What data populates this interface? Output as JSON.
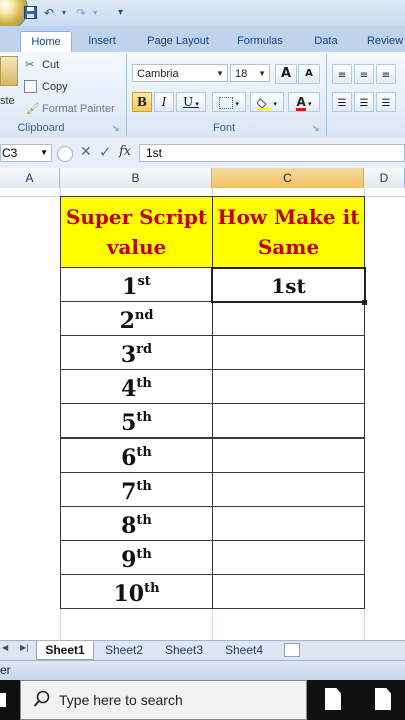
{
  "qat": {
    "icons": [
      "save-icon",
      "undo-icon",
      "redo-icon",
      "customize-icon"
    ]
  },
  "tabs": [
    {
      "label": "Home",
      "active": true
    },
    {
      "label": "Insert"
    },
    {
      "label": "Page Layout"
    },
    {
      "label": "Formulas"
    },
    {
      "label": "Data"
    },
    {
      "label": "Review"
    }
  ],
  "clipboard": {
    "paste_label": "ste",
    "cut_label": "Cut",
    "copy_label": "Copy",
    "format_painter_label": "Format Painter",
    "group_label": "Clipboard"
  },
  "font": {
    "name": "Cambria",
    "size": "18",
    "grow": "A",
    "shrink": "A",
    "bold": "B",
    "italic": "I",
    "underline": "U",
    "color_letter": "A",
    "group_label": "Font",
    "fill_color": "#ffff00",
    "font_color": "#ff0000"
  },
  "formula_bar": {
    "name_box": "C3",
    "fx": "fx",
    "value": "1st"
  },
  "columns": [
    {
      "label": "A"
    },
    {
      "label": "B"
    },
    {
      "label": "C",
      "selected": true
    },
    {
      "label": "D"
    }
  ],
  "table": {
    "header_b_line1": "Super Script",
    "header_b_line2": "value",
    "header_c_line1": "How Make it",
    "header_c_line2": "Same",
    "header_fill": "#ffff00",
    "header_text_color": "#c00000",
    "rows": [
      {
        "num": "1",
        "sup": "st",
        "c": "1st"
      },
      {
        "num": "2",
        "sup": "nd",
        "c": ""
      },
      {
        "num": "3",
        "sup": "rd",
        "c": ""
      },
      {
        "num": "4",
        "sup": "th",
        "c": ""
      },
      {
        "num": "5",
        "sup": "th",
        "c": ""
      },
      {
        "num": "6",
        "sup": "th",
        "c": ""
      },
      {
        "num": "7",
        "sup": "th",
        "c": ""
      },
      {
        "num": "8",
        "sup": "th",
        "c": ""
      },
      {
        "num": "9",
        "sup": "th",
        "c": ""
      },
      {
        "num": "10",
        "sup": "th",
        "c": ""
      }
    ]
  },
  "sheets": [
    {
      "label": "Sheet1",
      "active": true
    },
    {
      "label": "Sheet2"
    },
    {
      "label": "Sheet3"
    },
    {
      "label": "Sheet4"
    }
  ],
  "status": {
    "text": "er"
  },
  "taskbar": {
    "search_placeholder": "Type here to search"
  }
}
